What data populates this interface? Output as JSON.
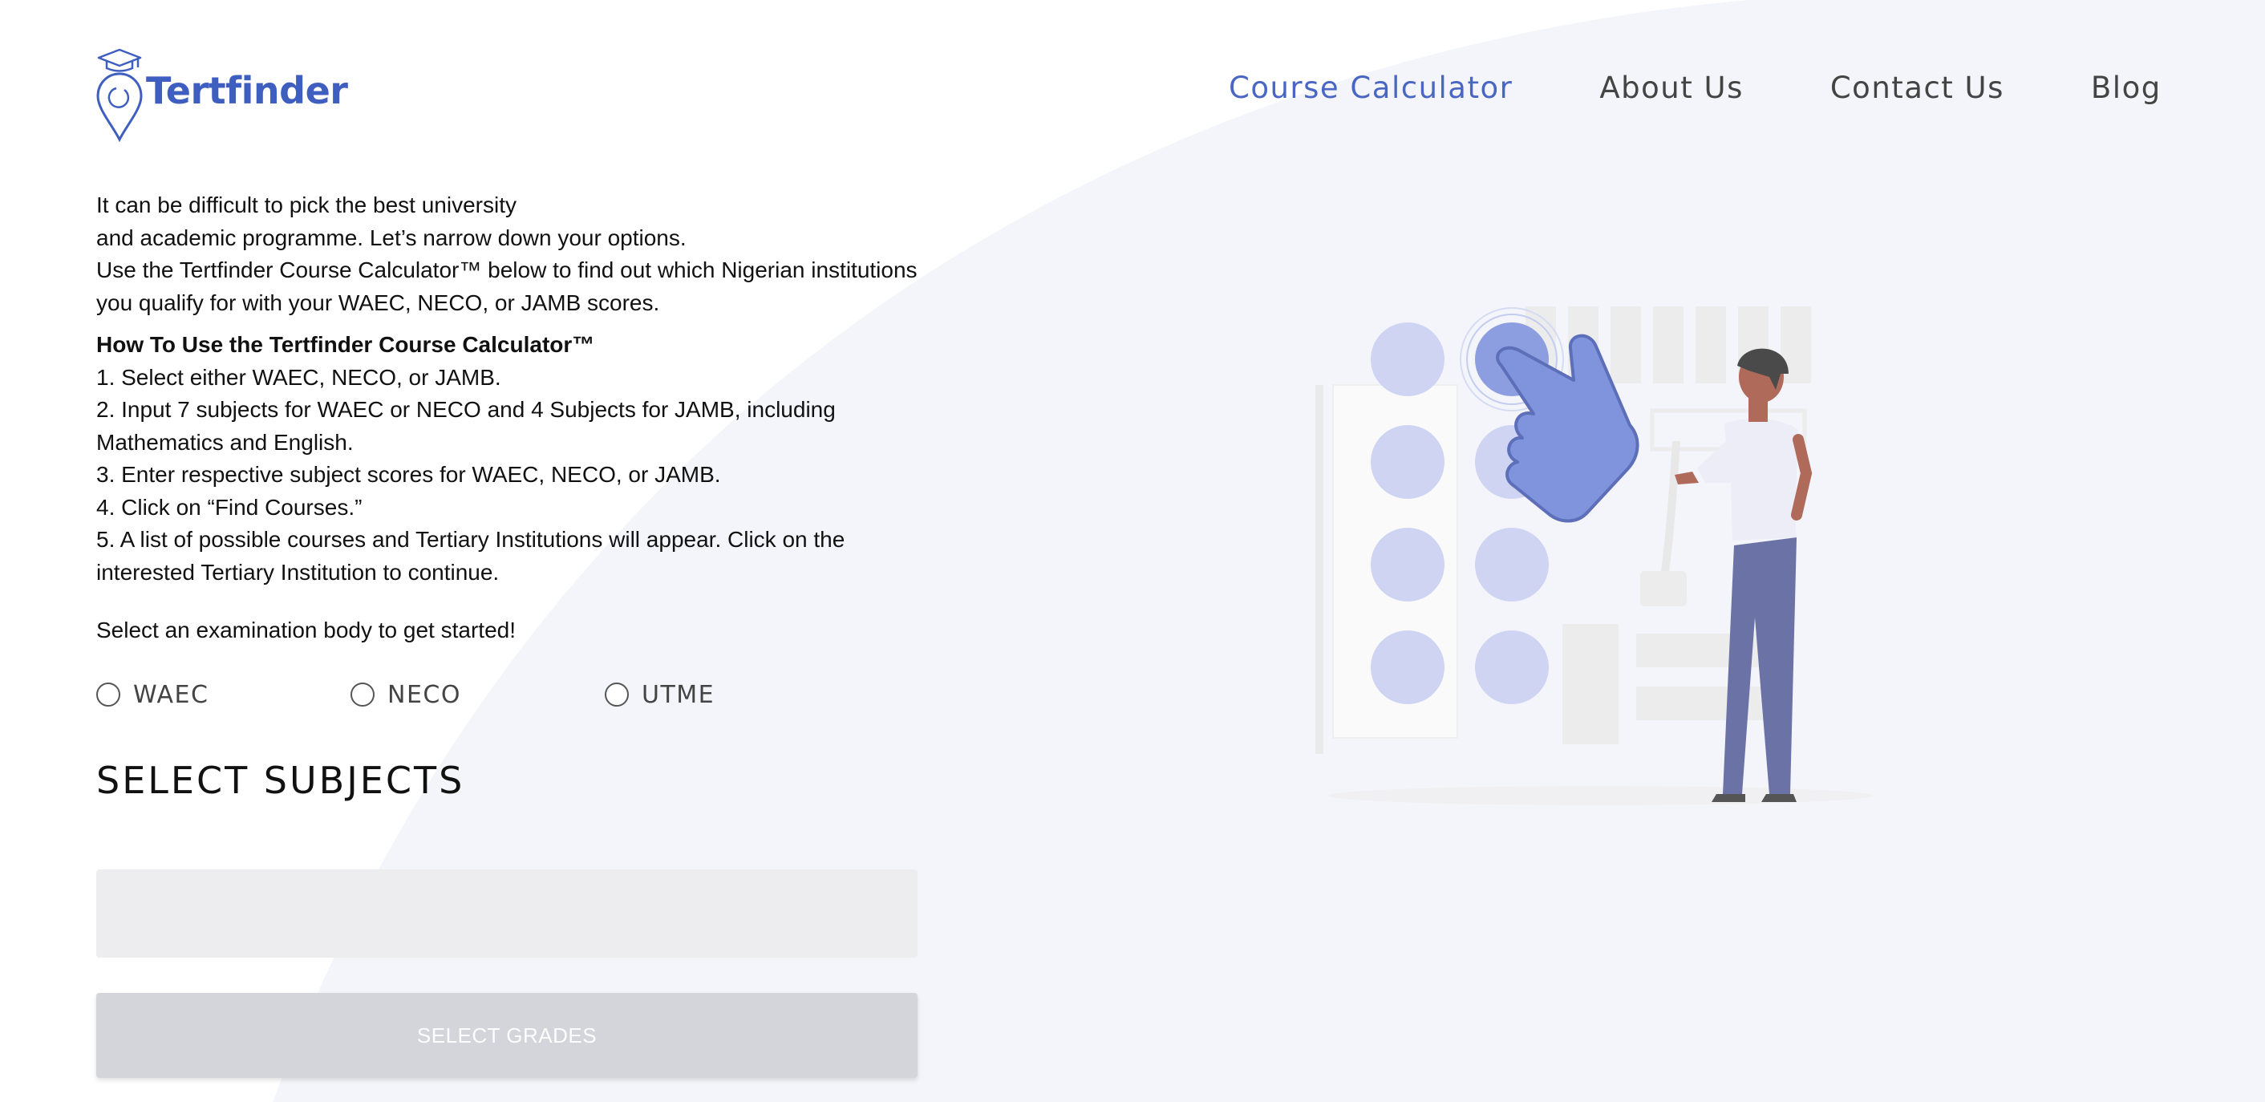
{
  "header": {
    "brand": "Tertfinder",
    "nav": [
      {
        "label": "Course Calculator",
        "active": true
      },
      {
        "label": "About Us",
        "active": false
      },
      {
        "label": "Contact Us",
        "active": false
      },
      {
        "label": "Blog",
        "active": false
      }
    ]
  },
  "intro": {
    "lines": [
      "It can be difficult to pick the best university",
      "and academic programme. Let’s narrow down your options.",
      "Use the Tertfinder Course Calculator™ below to find out which Nigerian institutions",
      "you qualify for with your WAEC, NECO, or JAMB scores."
    ]
  },
  "how_to": {
    "title": "How To Use the Tertfinder Course Calculator™",
    "lines": [
      "1. Select either WAEC, NECO, or JAMB.",
      "2. Input 7 subjects for WAEC or NECO and 4 Subjects for JAMB, including",
      "Mathematics and English.",
      "3. Enter respective subject scores for WAEC, NECO, or JAMB.",
      "4. Click on “Find Courses.”",
      "5. A list of possible courses and Tertiary Institutions will appear. Click on the",
      "interested Tertiary Institution to continue."
    ]
  },
  "start_text": "Select an examination body to get started!",
  "exam_options": [
    {
      "label": "WAEC",
      "selected": false
    },
    {
      "label": "NECO",
      "selected": false
    },
    {
      "label": "UTME",
      "selected": false
    }
  ],
  "subjects": {
    "heading": "SELECT SUBJECTS",
    "field_value": "",
    "grades_button": "SELECT GRADES"
  },
  "icons": {
    "logo": "graduation-cap-location-pin-icon",
    "illustration": "person-pressing-button-illustration"
  },
  "colors": {
    "brand": "#3f5fc0",
    "nav_active": "#4a66c4",
    "nav": "#444444",
    "background_blob": "#f4f5fa",
    "illustration_accent": "#7f94dc",
    "button_disabled": "#d3d5da",
    "field": "#ededf0"
  }
}
